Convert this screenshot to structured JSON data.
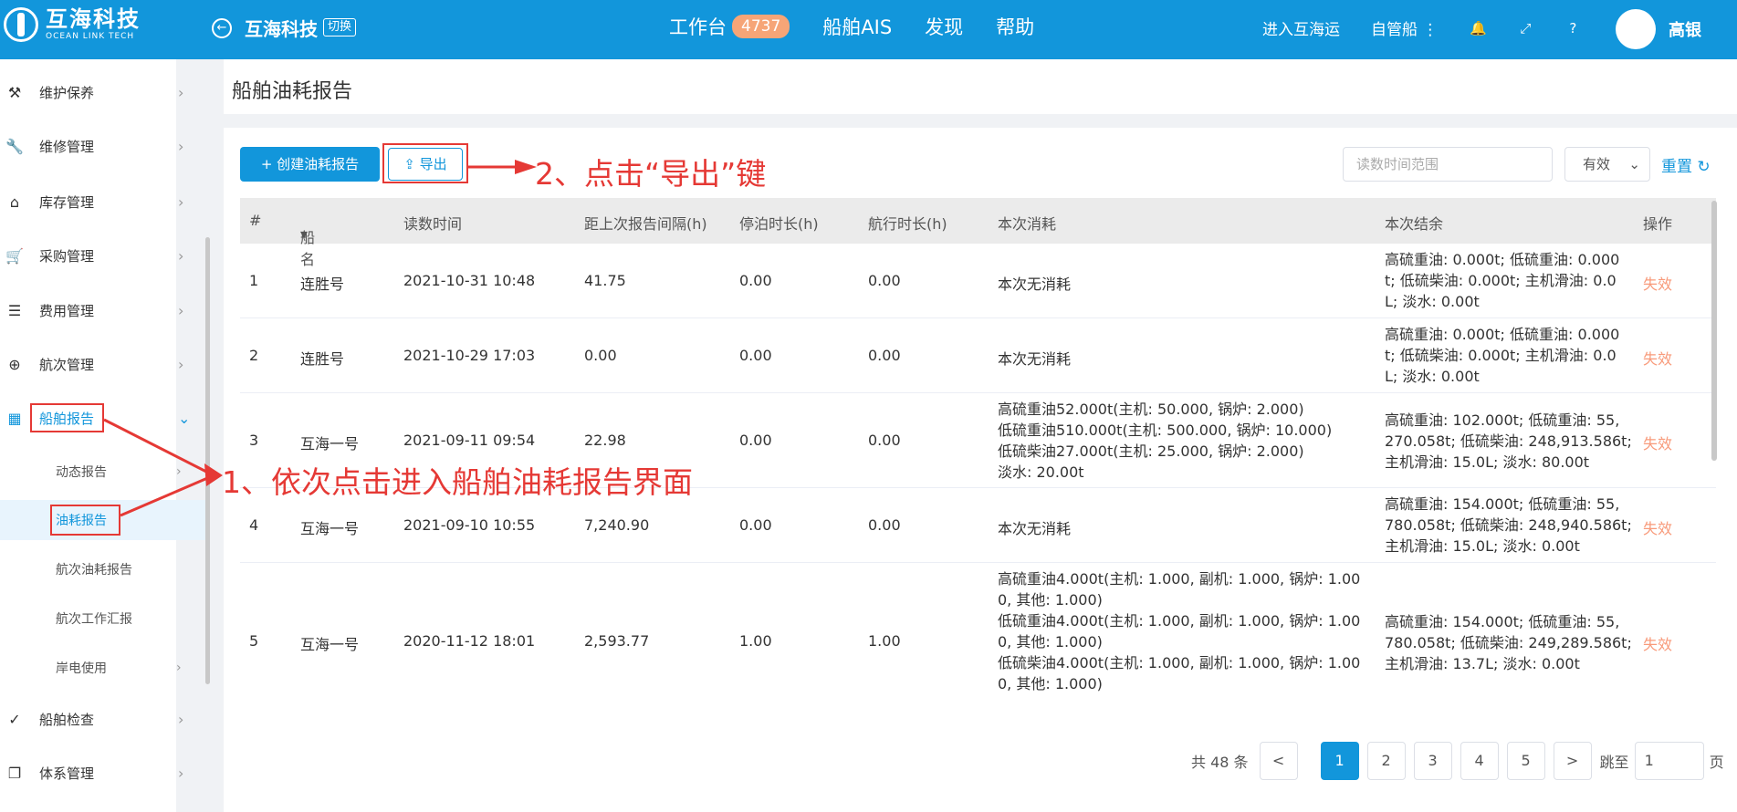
{
  "header": {
    "logo_cn": "互海科技",
    "logo_en": "OCEAN LINK TECH",
    "company": "互海科技",
    "switch_label": "切换",
    "nav": [
      "工作台",
      "船舶AIS",
      "发现",
      "帮助"
    ],
    "workbench_badge": "4737",
    "enter_label": "进入互海运",
    "self_ship_label": "自管船",
    "user_name": "高银"
  },
  "sidebar": {
    "items": [
      {
        "label": "维护保养",
        "icon": "hammer-icon"
      },
      {
        "label": "维修管理",
        "icon": "wrench-icon"
      },
      {
        "label": "库存管理",
        "icon": "home-icon"
      },
      {
        "label": "采购管理",
        "icon": "cart-icon"
      },
      {
        "label": "费用管理",
        "icon": "coins-icon"
      },
      {
        "label": "航次管理",
        "icon": "globe-icon"
      },
      {
        "label": "船舶报告",
        "icon": "calendar-icon"
      }
    ],
    "sub_items": [
      "动态报告",
      "油耗报告",
      "航次油耗报告",
      "航次工作汇报",
      "岸电使用"
    ],
    "bottom_items": [
      {
        "label": "船舶检查",
        "icon": "check-circle-icon"
      },
      {
        "label": "体系管理",
        "icon": "copy-icon"
      }
    ]
  },
  "page": {
    "title": "船舶油耗报告",
    "create_label": "+ 创建油耗报告",
    "export_label": "导出",
    "date_placeholder": "读数时间范围",
    "status_value": "有效",
    "reset_label": "重置"
  },
  "table": {
    "headers": [
      "#",
      "船名",
      "读数时间",
      "距上次报告间隔(h)",
      "停泊时长(h)",
      "航行时长(h)",
      "本次消耗",
      "本次结余",
      "操作"
    ],
    "rows": [
      {
        "no": "1",
        "ship": "连胜号",
        "time": "2021-10-31 10:48",
        "interval": "41.75",
        "berth": "0.00",
        "sail": "0.00",
        "consume": [
          "本次无消耗"
        ],
        "remain": [
          "高硫重油: 0.000t; 低硫重油: 0.000",
          "t; 低硫柴油: 0.000t; 主机滑油: 0.0",
          "L; 淡水: 0.00t"
        ],
        "op": "失效"
      },
      {
        "no": "2",
        "ship": "连胜号",
        "time": "2021-10-29 17:03",
        "interval": "0.00",
        "berth": "0.00",
        "sail": "0.00",
        "consume": [
          "本次无消耗"
        ],
        "remain": [
          "高硫重油: 0.000t; 低硫重油: 0.000",
          "t; 低硫柴油: 0.000t; 主机滑油: 0.0",
          "L; 淡水: 0.00t"
        ],
        "op": "失效"
      },
      {
        "no": "3",
        "ship": "互海一号",
        "time": "2021-09-11 09:54",
        "interval": "22.98",
        "berth": "0.00",
        "sail": "0.00",
        "consume": [
          "高硫重油52.000t(主机: 50.000, 锅炉: 2.000)",
          "低硫重油510.000t(主机: 500.000, 锅炉: 10.000)",
          "低硫柴油27.000t(主机: 25.000, 锅炉: 2.000)",
          "淡水: 20.00t"
        ],
        "remain": [
          "高硫重油: 102.000t; 低硫重油: 55,",
          "270.058t; 低硫柴油: 248,913.586t;",
          "主机滑油: 15.0L; 淡水: 80.00t"
        ],
        "op": "失效"
      },
      {
        "no": "4",
        "ship": "互海一号",
        "time": "2021-09-10 10:55",
        "interval": "7,240.90",
        "berth": "0.00",
        "sail": "0.00",
        "consume": [
          "本次无消耗"
        ],
        "remain": [
          "高硫重油: 154.000t; 低硫重油: 55,",
          "780.058t; 低硫柴油: 248,940.586t;",
          "主机滑油: 15.0L; 淡水: 0.00t"
        ],
        "op": "失效"
      },
      {
        "no": "5",
        "ship": "互海一号",
        "time": "2020-11-12 18:01",
        "interval": "2,593.77",
        "berth": "1.00",
        "sail": "1.00",
        "consume": [
          "高硫重油4.000t(主机: 1.000, 副机: 1.000, 锅炉: 1.00",
          "0, 其他: 1.000)",
          "低硫重油4.000t(主机: 1.000, 副机: 1.000, 锅炉: 1.00",
          "0, 其他: 1.000)",
          "低硫柴油4.000t(主机: 1.000, 副机: 1.000, 锅炉: 1.00",
          "0, 其他: 1.000)"
        ],
        "remain": [
          "高硫重油: 154.000t; 低硫重油: 55,",
          "780.058t; 低硫柴油: 249,289.586t;",
          "主机滑油: 13.7L; 淡水: 0.00t"
        ],
        "op": "失效"
      }
    ]
  },
  "pager": {
    "total": "共 48 条",
    "prev": "<",
    "pages": [
      "1",
      "2",
      "3",
      "4",
      "5"
    ],
    "next": ">",
    "jump_label": "跳至",
    "jump_value": "1",
    "page_unit": "页"
  },
  "annotations": {
    "step1": "1、依次点击进入船舶油耗报告界面",
    "step2": "2、点击“导出”键"
  },
  "colors": {
    "primary": "#1296db",
    "annotation": "#e53935",
    "invalid": "#f89a7a"
  }
}
